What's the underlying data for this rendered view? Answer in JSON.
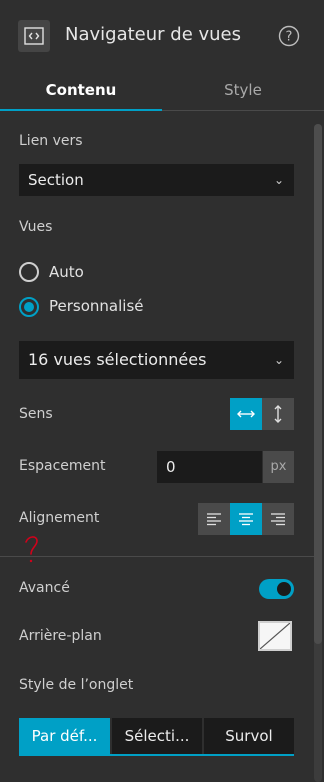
{
  "header": {
    "title": "Navigateur de vues",
    "widget_icon": "code-brackets-icon",
    "help_icon": "help-circle-icon"
  },
  "tabs": [
    {
      "label": "Contenu",
      "active": true
    },
    {
      "label": "Style",
      "active": false
    }
  ],
  "link": {
    "label": "Lien vers",
    "selected": "Section"
  },
  "views": {
    "label": "Vues",
    "options": [
      {
        "label": "Auto",
        "checked": false
      },
      {
        "label": "Personnalisé",
        "checked": true
      }
    ],
    "selection": "16 vues sélectionnées"
  },
  "direction": {
    "label": "Sens",
    "options": [
      "horizontal-arrows-icon",
      "vertical-arrows-icon"
    ],
    "selected_index": 0
  },
  "spacing": {
    "label": "Espacement",
    "value": "0",
    "unit": "px"
  },
  "alignment": {
    "label": "Alignement",
    "options": [
      "align-left-icon",
      "align-center-icon",
      "align-right-icon"
    ],
    "selected_index": 1
  },
  "annotation": "?",
  "advanced": {
    "label": "Avancé",
    "enabled": true
  },
  "background": {
    "label": "Arrière-plan",
    "value": "none"
  },
  "tab_style": {
    "label": "Style de l’onglet",
    "options": [
      "Par déf...",
      "Sélecti...",
      "Survol"
    ],
    "selected_index": 0
  },
  "colors": {
    "accent": "#00a0c6",
    "panel": "#2f2f2f",
    "field": "#1b1b1b",
    "annotation": "#d0021b"
  }
}
